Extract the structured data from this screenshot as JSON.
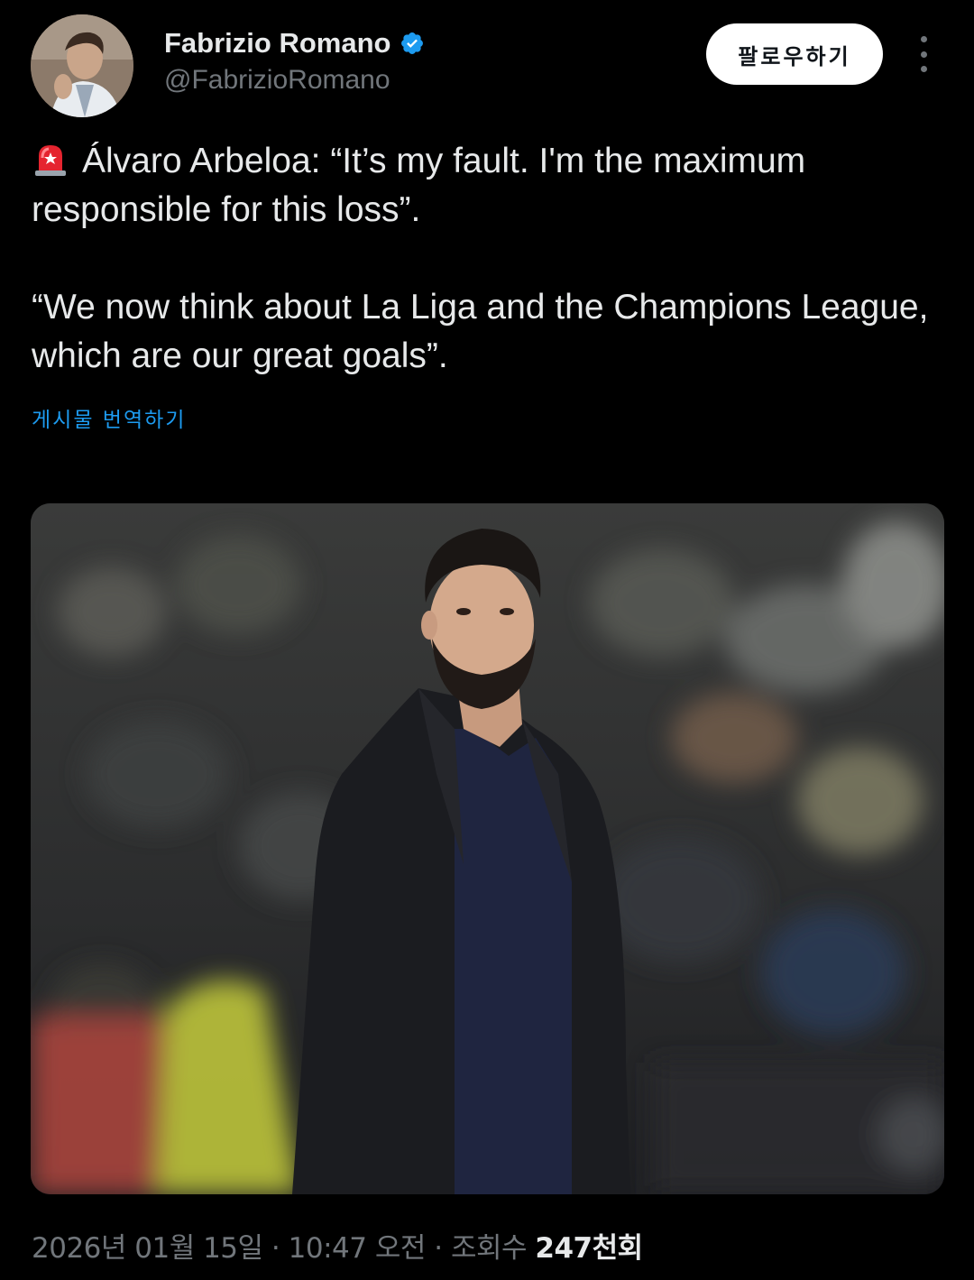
{
  "author": {
    "name": "Fabrizio Romano",
    "handle": "@FabrizioRomano",
    "verified": true
  },
  "follow_label": "팔로우하기",
  "tweet": {
    "emoji_icon": "siren-icon",
    "paragraph1": "Álvaro Arbeloa: “It’s my fault. I'm the maximum responsible for this loss”.",
    "paragraph2": "“We now think about La Liga and the Champions League, which are our great goals”."
  },
  "translate_label": "게시물 번역하기",
  "meta": {
    "date": "2026년 01월 15일",
    "separator": "·",
    "time": "10:47 오전",
    "views_label": "조회수",
    "views_value": "247천회"
  },
  "colors": {
    "background": "#000000",
    "text": "#e7e9ea",
    "muted": "#71767b",
    "accent": "#1d9bf0"
  }
}
